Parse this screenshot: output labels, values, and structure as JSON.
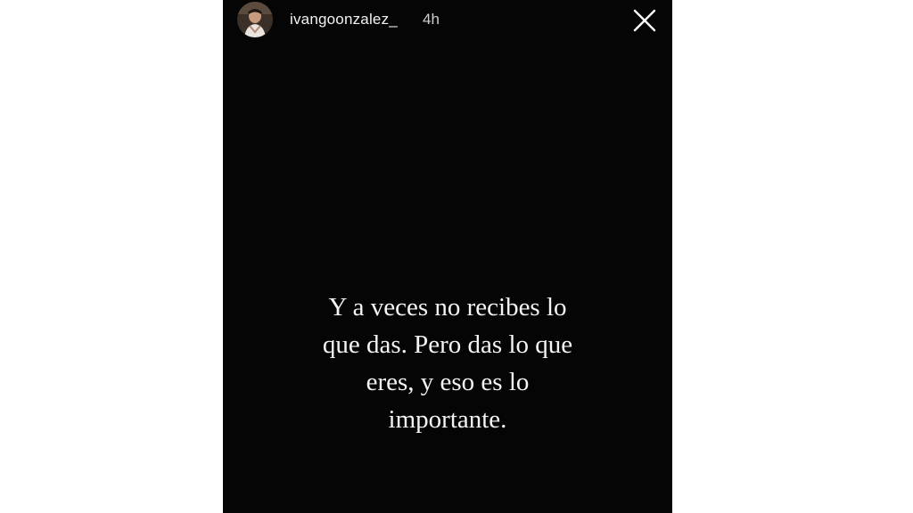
{
  "story": {
    "header": {
      "username": "ivangoonzalez_",
      "timestamp": "4h",
      "avatar_icon": "user-avatar-photo",
      "close_icon": "close-icon"
    },
    "caption": {
      "lines": [
        "Y a veces no recibes lo",
        "que das. Pero das lo que",
        "eres, y eso es lo",
        "importante."
      ]
    },
    "colors": {
      "background": "#050505",
      "text": "#f4f4f4",
      "page_background": "#ffffff"
    }
  }
}
